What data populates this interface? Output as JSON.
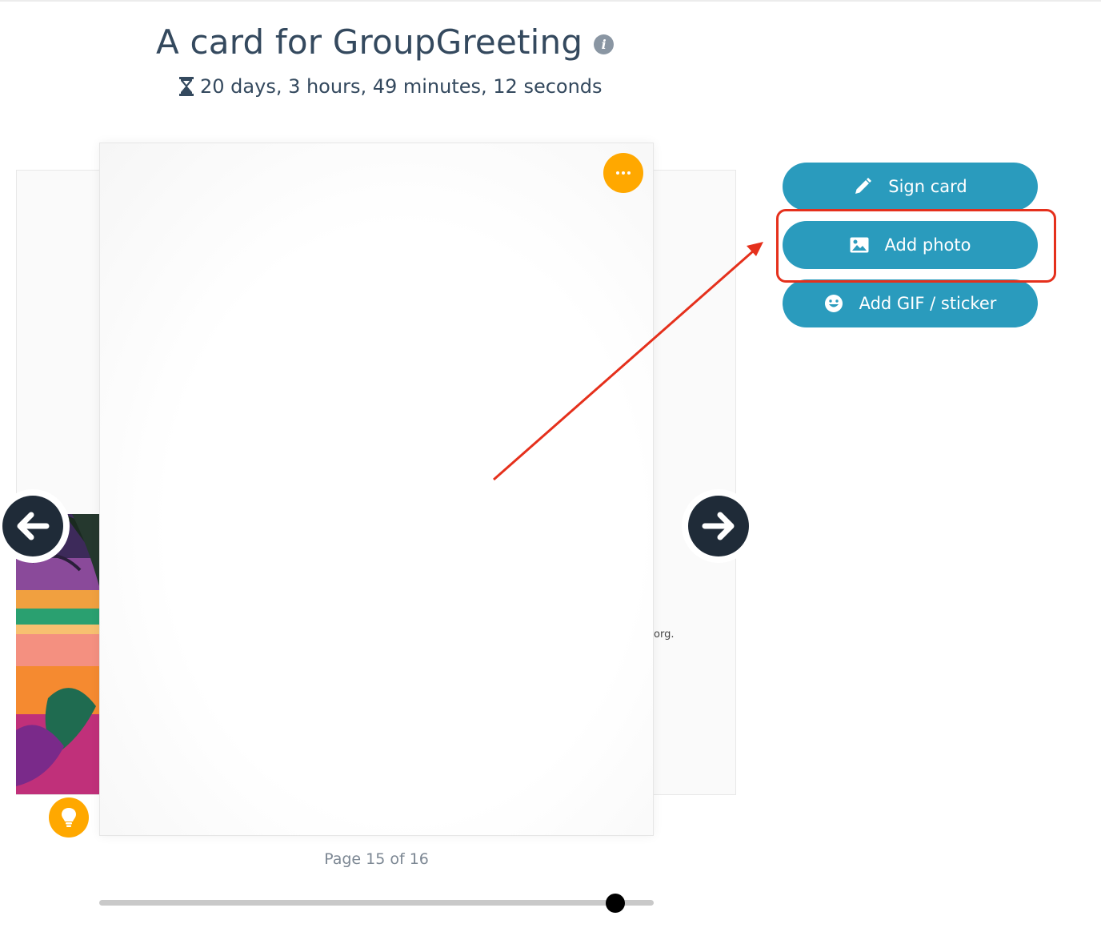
{
  "header": {
    "title": "A card for GroupGreeting",
    "info_icon": "info-circle-icon",
    "countdown_icon": "hourglass-icon",
    "countdown": "20 days, 3 hours, 49 minutes, 12 seconds"
  },
  "card": {
    "back_page_text": "org.",
    "menu_icon": "ellipsis-icon",
    "prev_icon": "arrow-left-icon",
    "next_icon": "arrow-right-icon",
    "tip_icon": "lightbulb-icon"
  },
  "pagination": {
    "label": "Page 15 of 16",
    "current_page": 15,
    "total_pages": 16
  },
  "actions": {
    "sign_card": {
      "label": "Sign card",
      "icon": "pencil-icon"
    },
    "add_photo": {
      "label": "Add photo",
      "icon": "image-icon"
    },
    "add_gif": {
      "label": "Add GIF / sticker",
      "icon": "smiley-icon"
    }
  },
  "annotation": {
    "color": "#e5301c",
    "target": "add_photo"
  },
  "colors": {
    "primary_button": "#2a9bbd",
    "accent_orange": "#ffa800",
    "nav_dark": "#1f2b38",
    "title_text": "#34495e"
  }
}
